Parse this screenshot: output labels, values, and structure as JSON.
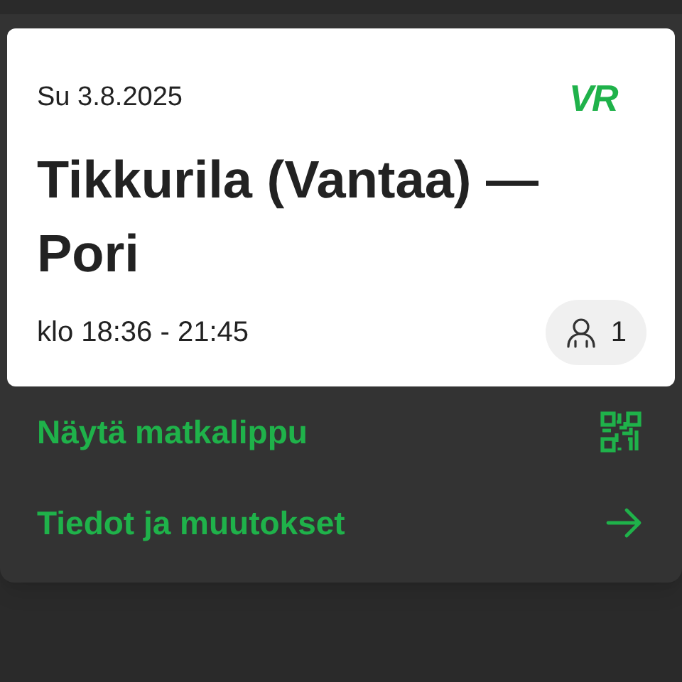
{
  "trip": {
    "date": "Su 3.8.2025",
    "logo": "VR",
    "route": "Tikkurila (Vantaa) —\nPori",
    "time": "klo 18:36 - 21:45",
    "passengers": "1"
  },
  "actions": [
    {
      "label": "Näytä matkalippu",
      "kind": "qr"
    },
    {
      "label": "Tiedot ja muutokset",
      "kind": "arrow"
    }
  ]
}
